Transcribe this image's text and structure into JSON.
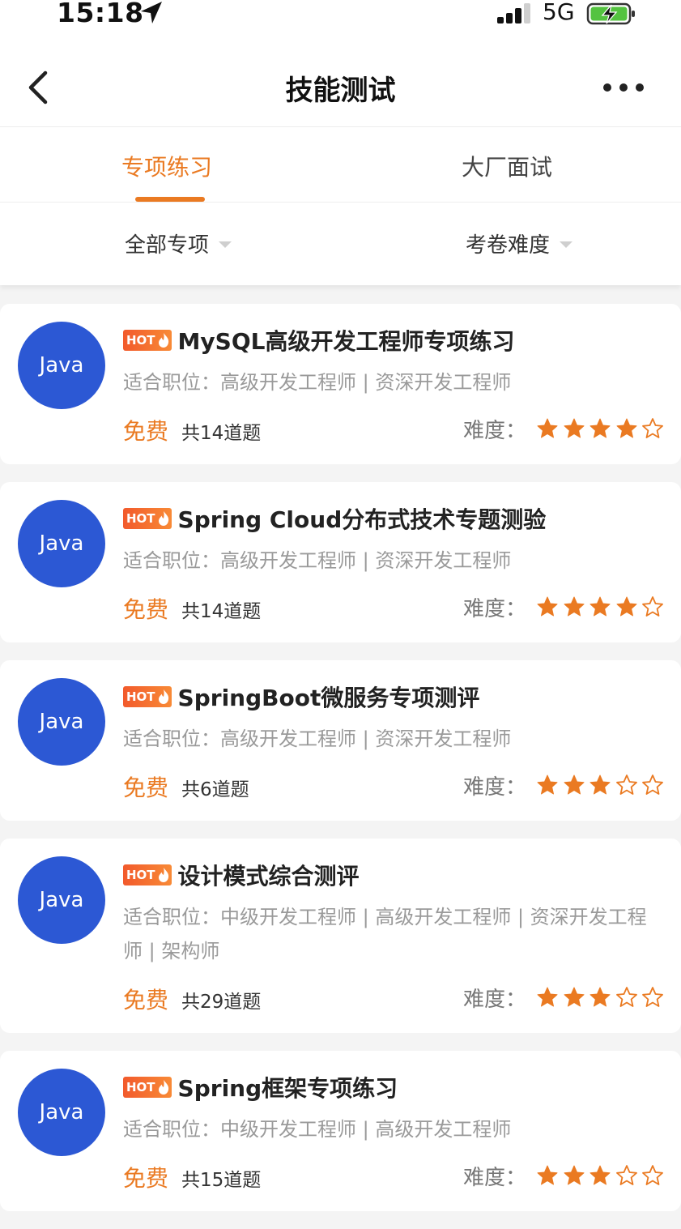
{
  "status_bar": {
    "time": "15:18",
    "network": "5G"
  },
  "nav": {
    "title": "技能测试"
  },
  "tabs": [
    {
      "label": "专项练习"
    },
    {
      "label": "大厂面试"
    }
  ],
  "filters": [
    {
      "label": "全部专项"
    },
    {
      "label": "考卷难度"
    }
  ],
  "colors": {
    "accent": "#ea7a22",
    "avatar": "#2c58d4"
  },
  "cards": [
    {
      "avatar": "Java",
      "badge": "HOT",
      "title": "MySQL高级开发工程师专项练习",
      "positions": "适合职位：高级开发工程师 | 资深开发工程师",
      "price": "免费",
      "count": "共14道题",
      "difficulty_label": "难度：",
      "stars": 4
    },
    {
      "avatar": "Java",
      "badge": "HOT",
      "title": "Spring Cloud分布式技术专题测验",
      "positions": "适合职位：高级开发工程师 | 资深开发工程师",
      "price": "免费",
      "count": "共14道题",
      "difficulty_label": "难度：",
      "stars": 4
    },
    {
      "avatar": "Java",
      "badge": "HOT",
      "title": "SpringBoot微服务专项测评",
      "positions": "适合职位：高级开发工程师 | 资深开发工程师",
      "price": "免费",
      "count": "共6道题",
      "difficulty_label": "难度：",
      "stars": 3
    },
    {
      "avatar": "Java",
      "badge": "HOT",
      "title": "设计模式综合测评",
      "positions": "适合职位：中级开发工程师 | 高级开发工程师 | 资深开发工程师 | 架构师",
      "price": "免费",
      "count": "共29道题",
      "difficulty_label": "难度：",
      "stars": 3
    },
    {
      "avatar": "Java",
      "badge": "HOT",
      "title": "Spring框架专项练习",
      "positions": "适合职位：中级开发工程师 | 高级开发工程师",
      "price": "免费",
      "count": "共15道题",
      "difficulty_label": "难度：",
      "stars": 3
    }
  ]
}
